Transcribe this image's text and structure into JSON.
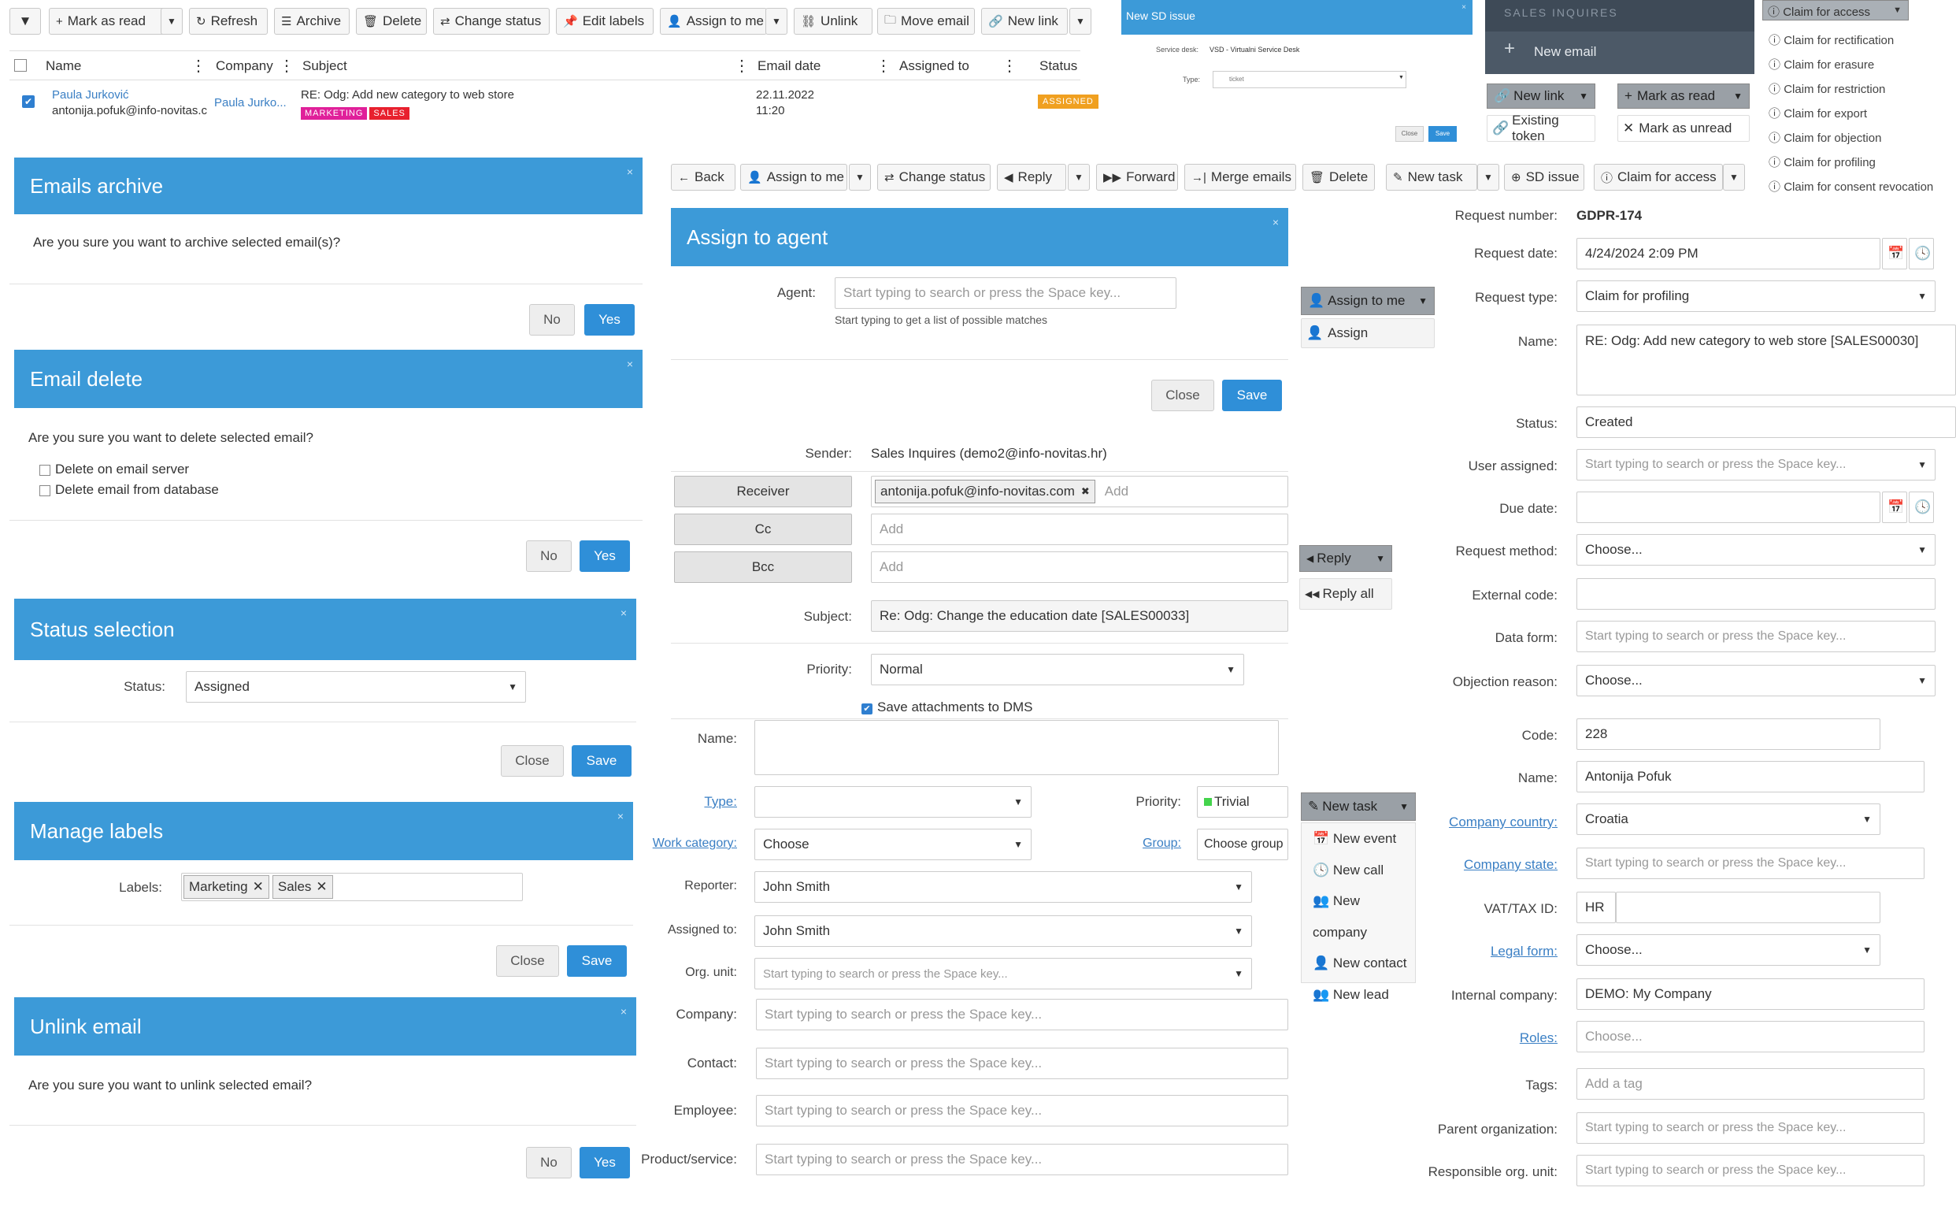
{
  "toolbar": {
    "mark_as_read": "Mark as read",
    "refresh": "Refresh",
    "archive": "Archive",
    "delete": "Delete",
    "change_status": "Change status",
    "edit_labels": "Edit labels",
    "assign_to_me": "Assign to me",
    "unlink": "Unlink",
    "move_email": "Move email",
    "new_link": "New link"
  },
  "grid": {
    "headers": [
      "Name",
      "Company",
      "Subject",
      "Email date",
      "Assigned to",
      "Status"
    ],
    "row": {
      "name": "Paula Jurković",
      "email": "antonija.pofuk@info-novitas.c",
      "company": "Paula Jurko...",
      "subject": "RE: Odg: Add new category to web store",
      "labels": [
        "MARKETING",
        "SALES"
      ],
      "date": "22.11.2022",
      "time": "11:20",
      "status": "ASSIGNED"
    }
  },
  "sd_issue": {
    "title": "New SD issue",
    "service_desk_label": "Service desk:",
    "service_desk_value": "VSD - Virtualni Service Desk",
    "type_label": "Type:",
    "type_value": "ticket",
    "close": "Close",
    "save": "Save"
  },
  "sales_panel": {
    "title": "SALES INQUIRES",
    "new_email": "New email",
    "new_link": "New link",
    "existing_token": "Existing token",
    "mark_as_read": "Mark as read",
    "mark_as_unread": "Mark as unread"
  },
  "claims": {
    "header": "Claim for access",
    "items": [
      "Claim for rectification",
      "Claim for erasure",
      "Claim for restriction",
      "Claim for export",
      "Claim for objection",
      "Claim for profiling",
      "Claim for consent revocation"
    ]
  },
  "archive_dialog": {
    "title": "Emails archive",
    "message": "Are you sure you want to archive selected email(s)?",
    "no": "No",
    "yes": "Yes"
  },
  "delete_dialog": {
    "title": "Email delete",
    "message": "Are you sure you want to delete selected email?",
    "opt1": "Delete on email server",
    "opt2": "Delete email from database",
    "no": "No",
    "yes": "Yes"
  },
  "status_dialog": {
    "title": "Status selection",
    "label": "Status:",
    "value": "Assigned",
    "close": "Close",
    "save": "Save"
  },
  "labels_dialog": {
    "title": "Manage labels",
    "label": "Labels:",
    "tags": [
      "Marketing",
      "Sales"
    ],
    "close": "Close",
    "save": "Save"
  },
  "unlink_dialog": {
    "title": "Unlink email",
    "message": "Are you sure you want to unlink selected email?",
    "no": "No",
    "yes": "Yes"
  },
  "email_toolbar": {
    "back": "Back",
    "assign_to_me": "Assign to me",
    "change_status": "Change status",
    "reply": "Reply",
    "forward": "Forward",
    "merge_emails": "Merge emails",
    "delete": "Delete",
    "new_task": "New task",
    "sd_issue": "SD issue",
    "claim_for_access": "Claim for access"
  },
  "assign_dialog": {
    "title": "Assign to agent",
    "agent_label": "Agent:",
    "agent_placeholder": "Start typing to search or press the Space key...",
    "hint": "Start typing to get a list of possible matches",
    "close": "Close",
    "save": "Save"
  },
  "assign_menu": {
    "header": "Assign to me",
    "item": "Assign"
  },
  "reply_menu": {
    "header": "Reply",
    "item": "Reply all"
  },
  "newtask_menu": {
    "header": "New task",
    "items": [
      "New event",
      "New call",
      "New company",
      "New contact",
      "New lead"
    ]
  },
  "reply_form": {
    "sender_label": "Sender:",
    "sender_value": "Sales Inquires (demo2@info-novitas.hr)",
    "receiver": "Receiver",
    "receiver_tag": "antonija.pofuk@info-novitas.com",
    "add": "Add",
    "cc": "Cc",
    "bcc": "Bcc",
    "subject_label": "Subject:",
    "subject_value": "Re: Odg: Change the education date [SALES00033]",
    "priority_label": "Priority:",
    "priority_value": "Normal"
  },
  "task_form": {
    "save_attachments": "Save attachments to DMS",
    "name_label": "Name:",
    "type_label": "Type:",
    "priority_label": "Priority:",
    "priority_value": "Trivial",
    "work_category_label": "Work category:",
    "work_category_value": "Choose",
    "group_label": "Group:",
    "group_value": "Choose group",
    "reporter_label": "Reporter:",
    "reporter_value": "John Smith",
    "assigned_label": "Assigned to:",
    "assigned_value": "John Smith",
    "org_unit_label": "Org. unit:",
    "company_label": "Company:",
    "contact_label": "Contact:",
    "employee_label": "Employee:",
    "product_label": "Product/service:",
    "placeholder": "Start typing to search or press the Space key..."
  },
  "gdpr_form": {
    "request_number_label": "Request number:",
    "request_number_value": "GDPR-174",
    "request_date_label": "Request date:",
    "request_date_value": "4/24/2024 2:09 PM",
    "request_type_label": "Request type:",
    "request_type_value": "Claim for profiling",
    "name_label": "Name:",
    "name_value": "RE: Odg: Add new category to web store [SALES00030]",
    "status_label": "Status:",
    "status_value": "Created",
    "user_assigned_label": "User assigned:",
    "due_date_label": "Due date:",
    "request_method_label": "Request method:",
    "choose": "Choose...",
    "external_code_label": "External code:",
    "data_form_label": "Data form:",
    "objection_reason_label": "Objection reason:",
    "code_label": "Code:",
    "code_value": "228",
    "name2_label": "Name:",
    "name2_value": "Antonija Pofuk",
    "company_country_label": "Company country:",
    "company_country_value": "Croatia",
    "company_state_label": "Company state:",
    "vat_label": "VAT/TAX ID:",
    "vat_prefix": "HR",
    "legal_form_label": "Legal form:",
    "internal_company_label": "Internal company:",
    "internal_company_value": "DEMO: My Company",
    "roles_label": "Roles:",
    "roles_placeholder": "Choose...",
    "tags_label": "Tags:",
    "tags_placeholder": "Add a tag",
    "parent_org_label": "Parent organization:",
    "resp_org_label": "Responsible org. unit:",
    "placeholder": "Start typing to search or press the Space key..."
  },
  "colors": {
    "dialog_header": "#3c9ad8",
    "primary_button": "#2f8fd8",
    "badge_marketing": "#e0209a",
    "badge_sales": "#e8202e",
    "badge_assigned": "#f0a020",
    "dark_panel": "#3e4a57"
  }
}
